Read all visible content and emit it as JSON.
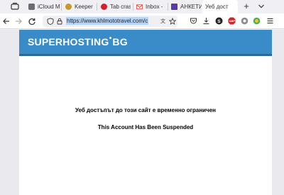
{
  "tabs": [
    {
      "label": "iCloud M",
      "favicon": "icloud-icon",
      "color": "#6b6b73"
    },
    {
      "label": "Keeper",
      "favicon": "keeper-icon",
      "color": "#c8982a"
    },
    {
      "label": "Tab cras",
      "favicon": "crash-icon",
      "color": "#d4202a"
    },
    {
      "label": "Inbox -",
      "favicon": "gmail-icon",
      "color": "#d93025"
    },
    {
      "label": "АНКЕТИ",
      "favicon": "survey-icon",
      "color": "#5b3aa8"
    },
    {
      "label": "Уеб дост",
      "favicon": "page-icon",
      "color": "#ffffff",
      "active": true
    }
  ],
  "navbar": {
    "url": "https://www.khlmototravel.com/c"
  },
  "page": {
    "brand": "SUPERHOSTING",
    "brand_suffix": "BG",
    "message_bg": "Уеб достъпът до този сайт е временно ограничен",
    "message_en": "This Account Has Been Suspended",
    "header_color": "#3a8cc8"
  }
}
